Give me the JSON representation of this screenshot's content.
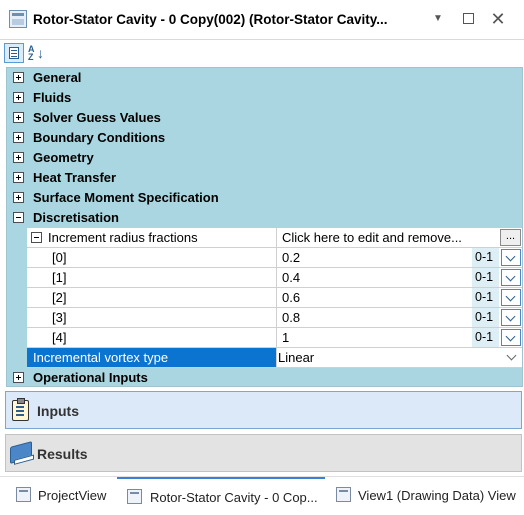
{
  "window": {
    "title": "Rotor-Stator Cavity - 0 Copy(002) (Rotor-Stator Cavity...",
    "menu_glyph": "▼",
    "close_glyph": "✕"
  },
  "toolbar": {
    "categorized_icon": "categorized-view-icon",
    "alphabetical_icon": "sort-az-icon",
    "az_a": "A",
    "az_z": "Z",
    "az_arrow": "↓"
  },
  "property_grid": {
    "categories": [
      {
        "label": "General",
        "expanded": false
      },
      {
        "label": "Fluids",
        "expanded": false
      },
      {
        "label": "Solver Guess Values",
        "expanded": false
      },
      {
        "label": "Boundary Conditions",
        "expanded": false
      },
      {
        "label": "Geometry",
        "expanded": false
      },
      {
        "label": "Heat Transfer",
        "expanded": false
      },
      {
        "label": "Surface Moment Specification",
        "expanded": false
      },
      {
        "label": "Discretisation",
        "expanded": true
      },
      {
        "label": "Operational Inputs",
        "expanded": false
      }
    ],
    "increment_radius": {
      "label": "Increment radius fractions",
      "value": "Click here to edit and remove...",
      "button_label": "...",
      "items": [
        {
          "index": "[0]",
          "value": "0.2",
          "unit": "0-1"
        },
        {
          "index": "[1]",
          "value": "0.4",
          "unit": "0-1"
        },
        {
          "index": "[2]",
          "value": "0.6",
          "unit": "0-1"
        },
        {
          "index": "[3]",
          "value": "0.8",
          "unit": "0-1"
        },
        {
          "index": "[4]",
          "value": "1",
          "unit": "0-1"
        }
      ]
    },
    "vortex_type": {
      "label": "Incremental vortex type",
      "value": "Linear"
    }
  },
  "nav": {
    "inputs_label": "Inputs",
    "results_label": "Results"
  },
  "tabs": [
    {
      "label": "ProjectView"
    },
    {
      "label": "Rotor-Stator Cavity - 0 Cop..."
    },
    {
      "label": "View1 (Drawing Data) View"
    }
  ],
  "colors": {
    "grid_background": "#a9d6e0",
    "selection": "#0a74d0",
    "active_tab_accent": "#3c7fd6"
  }
}
